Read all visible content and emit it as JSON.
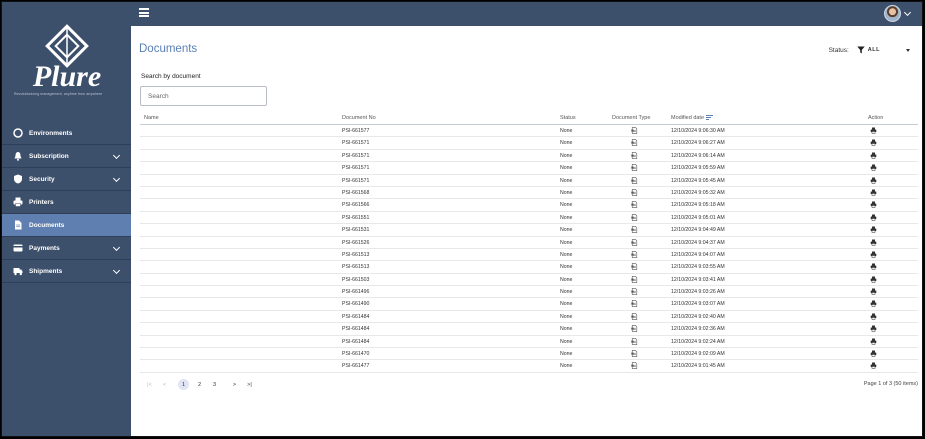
{
  "app": {
    "brand": "Plure",
    "tagline": "Revolutionizing management, anytime from anywhere"
  },
  "sidebar": {
    "items": [
      {
        "label": "Environments",
        "icon": "compass-icon",
        "expandable": false,
        "active": false
      },
      {
        "label": "Subscription",
        "icon": "bell-icon",
        "expandable": true,
        "active": false
      },
      {
        "label": "Security",
        "icon": "shield-icon",
        "expandable": true,
        "active": false
      },
      {
        "label": "Printers",
        "icon": "printer-icon",
        "expandable": false,
        "active": false
      },
      {
        "label": "Documents",
        "icon": "document-icon",
        "expandable": false,
        "active": true
      },
      {
        "label": "Payments",
        "icon": "credit-card-icon",
        "expandable": true,
        "active": false
      },
      {
        "label": "Shipments",
        "icon": "truck-icon",
        "expandable": true,
        "active": false
      }
    ]
  },
  "header": {
    "title": "Documents",
    "status_label": "Status:",
    "status_value": "ALL"
  },
  "search": {
    "label": "Search by document",
    "placeholder": "Search",
    "value": ""
  },
  "table": {
    "columns": {
      "name": "Name",
      "document_no": "Document No",
      "status": "Status",
      "document_type": "Document Type",
      "modified_date": "Modified date",
      "action": "Action"
    },
    "rows": [
      {
        "name": "",
        "document_no": "PSI-661577",
        "status": "None",
        "modified_date": "12/10/2024 9:06:30 AM"
      },
      {
        "name": "",
        "document_no": "PSI-661571",
        "status": "None",
        "modified_date": "12/10/2024 9:06:27 AM"
      },
      {
        "name": "",
        "document_no": "PSI-661571",
        "status": "None",
        "modified_date": "12/10/2024 9:06:14 AM"
      },
      {
        "name": "",
        "document_no": "PSI-661571",
        "status": "None",
        "modified_date": "12/10/2024 9:05:59 AM"
      },
      {
        "name": "",
        "document_no": "PSI-661571",
        "status": "None",
        "modified_date": "12/10/2024 9:05:45 AM"
      },
      {
        "name": "",
        "document_no": "PSI-661568",
        "status": "None",
        "modified_date": "12/10/2024 9:05:32 AM"
      },
      {
        "name": "",
        "document_no": "PSI-661566",
        "status": "None",
        "modified_date": "12/10/2024 9:05:18 AM"
      },
      {
        "name": "",
        "document_no": "PSI-661551",
        "status": "None",
        "modified_date": "12/10/2024 9:05:01 AM"
      },
      {
        "name": "",
        "document_no": "PSI-661531",
        "status": "None",
        "modified_date": "12/10/2024 9:04:49 AM"
      },
      {
        "name": "",
        "document_no": "PSI-661526",
        "status": "None",
        "modified_date": "12/10/2024 9:04:37 AM"
      },
      {
        "name": "",
        "document_no": "PSI-661513",
        "status": "None",
        "modified_date": "12/10/2024 9:04:07 AM"
      },
      {
        "name": "",
        "document_no": "PSI-661513",
        "status": "None",
        "modified_date": "12/10/2024 9:03:55 AM"
      },
      {
        "name": "",
        "document_no": "PSI-661503",
        "status": "None",
        "modified_date": "12/10/2024 9:03:41 AM"
      },
      {
        "name": "",
        "document_no": "PSI-661496",
        "status": "None",
        "modified_date": "12/10/2024 9:03:26 AM"
      },
      {
        "name": "",
        "document_no": "PSI-661490",
        "status": "None",
        "modified_date": "12/10/2024 9:03:07 AM"
      },
      {
        "name": "",
        "document_no": "PSI-661484",
        "status": "None",
        "modified_date": "12/10/2024 9:02:40 AM"
      },
      {
        "name": "",
        "document_no": "PSI-661484",
        "status": "None",
        "modified_date": "12/10/2024 9:02:36 AM"
      },
      {
        "name": "",
        "document_no": "PSI-661484",
        "status": "None",
        "modified_date": "12/10/2024 9:02:24 AM"
      },
      {
        "name": "",
        "document_no": "PSI-661470",
        "status": "None",
        "modified_date": "12/10/2024 9:02:09 AM"
      },
      {
        "name": "",
        "document_no": "PSI-661477",
        "status": "None",
        "modified_date": "12/10/2024 9:01:45 AM"
      }
    ]
  },
  "pagination": {
    "first": "|<",
    "prev": "<",
    "pages": [
      "1",
      "2",
      "3"
    ],
    "current": "1",
    "next": ">",
    "last": ">|",
    "info": "Page 1 of 3 (50 items)"
  },
  "colors": {
    "sidebar_bg": "#3c4f6b",
    "active_item": "#5f7fb0",
    "title_blue": "#5a7fb5"
  }
}
